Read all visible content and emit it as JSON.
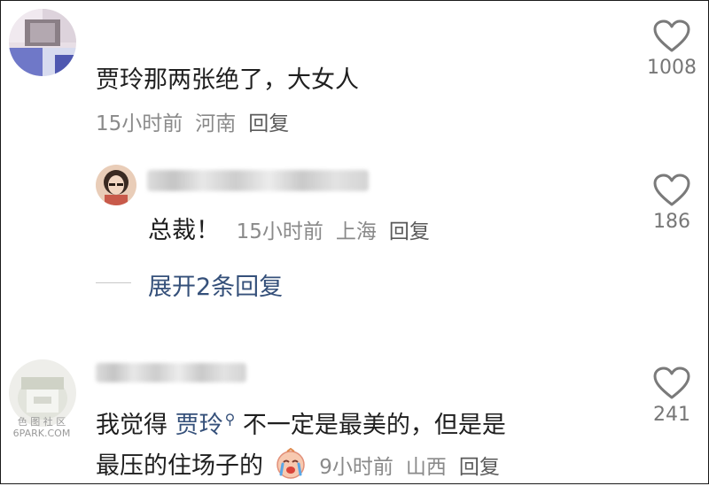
{
  "comments": [
    {
      "text": "贾玲那两张绝了，大女人",
      "time": "15小时前",
      "location": "河南",
      "reply_label": "回复",
      "likes": "1008"
    },
    {
      "text": "总裁！",
      "time": "15小时前",
      "location": "上海",
      "reply_label": "回复",
      "likes": "186"
    },
    {
      "text_before_mention": "我觉得 ",
      "mention": "贾玲",
      "text_after_mention": " 不一定是最美的，但是是",
      "text_line2": "最压的住场子的",
      "time": "9小时前",
      "location": "山西",
      "reply_label": "回复",
      "likes": "241"
    }
  ],
  "expand_replies": "展开2条回复",
  "watermark": {
    "line1": "色 图 社 区",
    "line2": "6PARK.COM"
  },
  "icons": {
    "like": "heart-outline-icon",
    "mention_search": "search-icon",
    "emoji": "crying-face-emoji-icon"
  },
  "colors": {
    "text": "#1f1f1f",
    "meta": "#8a8a8a",
    "link": "#35507a",
    "heart": "#7a7a7a"
  }
}
